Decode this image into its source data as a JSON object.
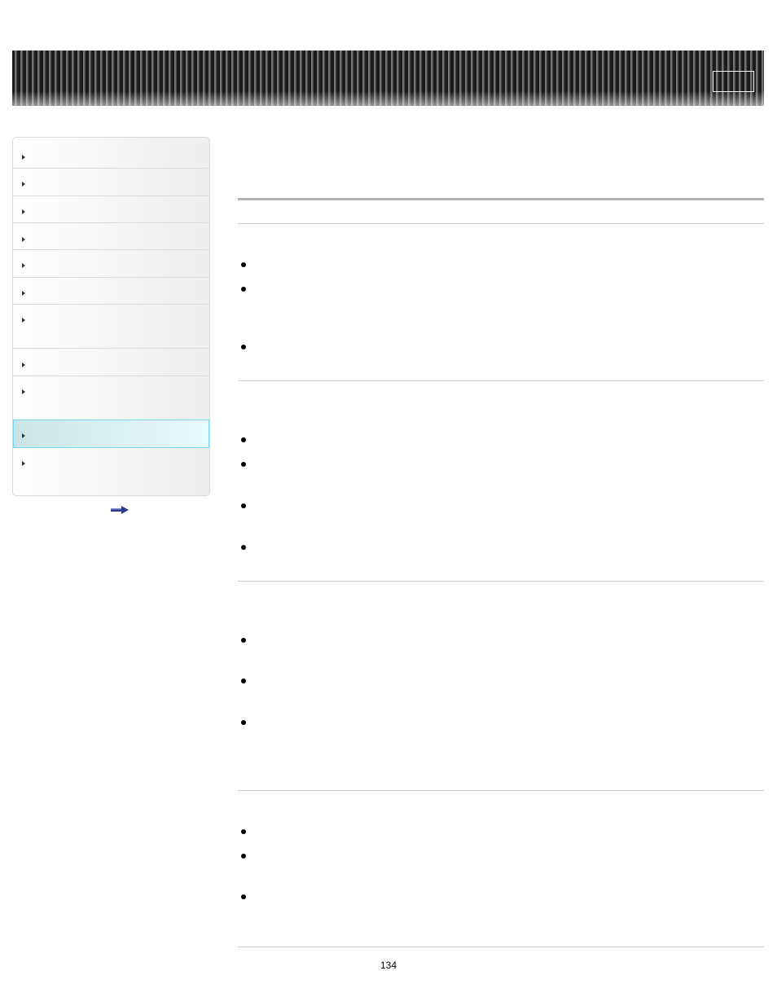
{
  "footer": {
    "page_number": "134"
  },
  "colors": {
    "selected_nav_border": "#78d6ee",
    "next_arrow": "#2b3a8f"
  },
  "icons": {
    "nav_item": "triangle-right-icon",
    "next_page": "arrow-right-icon"
  }
}
